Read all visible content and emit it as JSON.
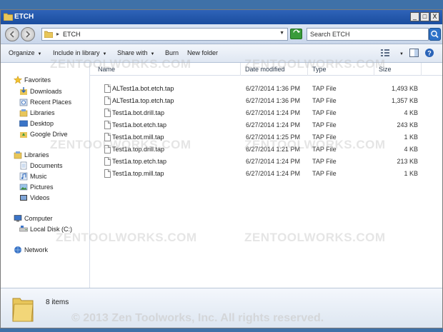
{
  "window": {
    "title": "ETCH",
    "buttons": {
      "minimize": "_",
      "maximize": "□",
      "close": "X"
    }
  },
  "address": {
    "separator": "▸",
    "path": "ETCH",
    "search_placeholder": "Search ETCH"
  },
  "toolbar": {
    "organize": "Organize",
    "include": "Include in library",
    "share": "Share with",
    "burn": "Burn",
    "new_folder": "New folder"
  },
  "nav": {
    "favorites": {
      "label": "Favorites",
      "icon": "star-icon"
    },
    "favorites_items": [
      {
        "label": "Downloads",
        "icon": "downloads-icon"
      },
      {
        "label": "Recent Places",
        "icon": "recent-places-icon"
      },
      {
        "label": "Libraries",
        "icon": "libraries-icon"
      },
      {
        "label": "Desktop",
        "icon": "desktop-icon"
      },
      {
        "label": "Google Drive",
        "icon": "google-drive-icon"
      }
    ],
    "libraries": {
      "label": "Libraries",
      "icon": "libraries-icon"
    },
    "libraries_items": [
      {
        "label": "Documents",
        "icon": "documents-icon"
      },
      {
        "label": "Music",
        "icon": "music-icon"
      },
      {
        "label": "Pictures",
        "icon": "pictures-icon"
      },
      {
        "label": "Videos",
        "icon": "videos-icon"
      }
    ],
    "computer": {
      "label": "Computer",
      "icon": "computer-icon"
    },
    "computer_items": [
      {
        "label": "Local Disk (C:)",
        "icon": "disk-icon"
      }
    ],
    "network": {
      "label": "Network",
      "icon": "network-icon"
    }
  },
  "columns": {
    "name": "Name",
    "date": "Date modified",
    "type": "Type",
    "size": "Size"
  },
  "files": [
    {
      "name": "ALTest1a.bot.etch.tap",
      "date": "6/27/2014 1:36 PM",
      "type": "TAP File",
      "size": "1,493 KB"
    },
    {
      "name": "ALTest1a.top.etch.tap",
      "date": "6/27/2014 1:36 PM",
      "type": "TAP File",
      "size": "1,357 KB"
    },
    {
      "name": "Test1a.bot.drill.tap",
      "date": "6/27/2014 1:24 PM",
      "type": "TAP File",
      "size": "4 KB"
    },
    {
      "name": "Test1a.bot.etch.tap",
      "date": "6/27/2014 1:24 PM",
      "type": "TAP File",
      "size": "243 KB"
    },
    {
      "name": "Test1a.bot.mill.tap",
      "date": "6/27/2014 1:25 PM",
      "type": "TAP File",
      "size": "1 KB"
    },
    {
      "name": "Test1a.top.drill.tap",
      "date": "6/27/2014 1:21 PM",
      "type": "TAP File",
      "size": "4 KB"
    },
    {
      "name": "Test1a.top.etch.tap",
      "date": "6/27/2014 1:24 PM",
      "type": "TAP File",
      "size": "213 KB"
    },
    {
      "name": "Test1a.top.mill.tap",
      "date": "6/27/2014 1:24 PM",
      "type": "TAP File",
      "size": "1 KB"
    }
  ],
  "status": {
    "count": "8 items"
  },
  "watermark": "ZENTOOLWORKS.COM",
  "copyright": "© 2013 Zen Toolworks, Inc. All rights reserved.",
  "colors": {
    "title_bar": "#1b4d9f",
    "desktop": "#3f71a8",
    "folder": "#e8c65a"
  }
}
